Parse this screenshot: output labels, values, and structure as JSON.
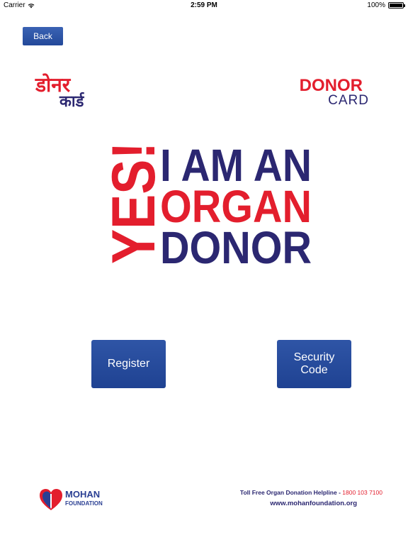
{
  "status_bar": {
    "carrier": "Carrier",
    "time": "2:59 PM",
    "battery": "100%",
    "battery_level": 1.0,
    "icons": [
      "wifi-icon",
      "battery-icon"
    ]
  },
  "nav": {
    "back_label": "Back"
  },
  "logos": {
    "hindi_line1": "डोनर",
    "hindi_line2": "कार्ड",
    "english_line1": "DONOR",
    "english_line2": "CARD"
  },
  "slogan": {
    "yes": "YES!",
    "line1": "I AM AN",
    "line2": "ORGAN",
    "line3": "DONOR"
  },
  "buttons": {
    "register": "Register",
    "security_code": "Security Code"
  },
  "footer": {
    "foundation_name": "MOHAN",
    "foundation_sub": "FOUNDATION",
    "helpline_text": "Toll Free Organ Donation Helpline - ",
    "helpline_number": "1800 103 7100",
    "website": "www.mohanfoundation.org"
  },
  "colors": {
    "red": "#e31e2d",
    "navy": "#2b2771",
    "button_blue": "#2a4c9f"
  }
}
